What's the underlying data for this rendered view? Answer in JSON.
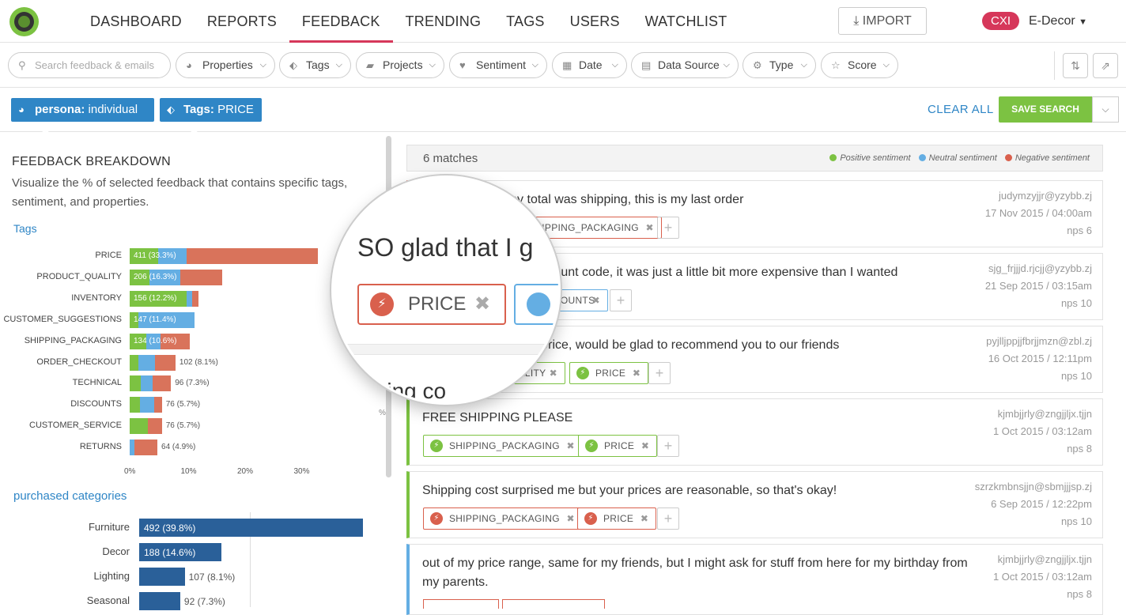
{
  "nav": {
    "items": [
      "DASHBOARD",
      "REPORTS",
      "FEEDBACK",
      "TRENDING",
      "TAGS",
      "USERS",
      "WATCHLIST"
    ],
    "active": "FEEDBACK",
    "import_label": "IMPORT",
    "brand_badge": "CXI",
    "org_name": "E-Decor"
  },
  "filters": {
    "search_placeholder": "Search feedback & emails",
    "buttons": [
      "Properties",
      "Tags",
      "Projects",
      "Sentiment",
      "Date",
      "Data Source",
      "Type",
      "Score"
    ]
  },
  "active_filters": {
    "chips": [
      {
        "key": "persona:",
        "value": "individual",
        "icon": "pie-chart-icon"
      },
      {
        "key": "Tags:",
        "value": "PRICE",
        "icon": "tag-icon"
      }
    ],
    "clear_all": "CLEAR ALL",
    "save_search": "SAVE SEARCH"
  },
  "breakdown": {
    "title": "FEEDBACK BREAKDOWN",
    "description": "Visualize the % of selected feedback that contains specific tags, sentiment, and properties.",
    "tags_label": "Tags",
    "categories_label": "purchased categories",
    "colors": {
      "positive": "#7cc242",
      "neutral": "#64aee3",
      "negative": "#d9735b",
      "category": "#2a6099"
    }
  },
  "chart_data": [
    {
      "type": "bar",
      "orientation": "horizontal",
      "stacked": true,
      "title": "Tags",
      "categories": [
        "PRICE",
        "PRODUCT_QUALITY",
        "INVENTORY",
        "CUSTOMER_SUGGESTIONS",
        "SHIPPING_PACKAGING",
        "ORDER_CHECKOUT",
        "TECHNICAL",
        "DISCOUNTS",
        "CUSTOMER_SERVICE",
        "RETURNS"
      ],
      "labels": [
        "411 (33.3%)",
        "206 (16.3%)",
        "156 (12.2%)",
        "147 (11.4%)",
        "134 (10.6%)",
        "102 (8.1%)",
        "96 (7.3%)",
        "76 (5.7%)",
        "76 (5.7%)",
        "64 (4.9%)"
      ],
      "series": [
        {
          "name": "Positive sentiment",
          "values": [
            5.0,
            3.5,
            10.0,
            1.5,
            3.0,
            1.5,
            2.0,
            1.8,
            3.2,
            0.0
          ]
        },
        {
          "name": "Neutral sentiment",
          "values": [
            5.0,
            5.5,
            1.0,
            9.9,
            2.5,
            3.0,
            2.0,
            2.5,
            0.0,
            0.8
          ]
        },
        {
          "name": "Negative sentiment",
          "values": [
            23.3,
            7.3,
            1.2,
            0.0,
            5.1,
            3.6,
            3.3,
            1.4,
            2.5,
            4.1
          ]
        }
      ],
      "xticks": [
        "0%",
        "10%",
        "20%",
        "30%"
      ],
      "xlim": [
        0,
        33.3
      ]
    },
    {
      "type": "bar",
      "orientation": "horizontal",
      "title": "purchased categories",
      "categories": [
        "Furniture",
        "Decor",
        "Lighting",
        "Seasonal"
      ],
      "values": [
        39.8,
        14.6,
        8.1,
        7.3
      ],
      "labels": [
        "492 (39.8%)",
        "188 (14.6%)",
        "107 (8.1%)",
        "92 (7.3%)"
      ],
      "xlim": [
        0,
        39.8
      ]
    }
  ],
  "results": {
    "matches": "6 matches",
    "legend": [
      {
        "label": "Positive sentiment",
        "color": "#7cc242"
      },
      {
        "label": "Neutral sentiment",
        "color": "#64aee3"
      },
      {
        "label": "Negative sentiment",
        "color": "#d9604d"
      }
    ],
    "cards": [
      {
        "text": "More than half my total was shipping, this is my last order",
        "email": "judymzyjjr@yzybb.zj",
        "date": "17 Nov 2015 / 04:00am",
        "nps": "nps 6",
        "sentiment": "negative",
        "tags": [
          {
            "label": "SHIPPING_PACKAGING",
            "sentiment": "negative"
          }
        ]
      },
      {
        "text": "discount code, it was just a little bit more expensive than I wanted",
        "email": "sjg_frjjjd.rjcjj@yzybb.zj",
        "date": "21 Sep 2015 / 03:15am",
        "nps": "nps 10",
        "sentiment": "neutral",
        "tags": [
          {
            "label": "DISCOUNTS",
            "sentiment": "neutral"
          }
        ]
      },
      {
        "text": "he price, would be glad to recommend you to our friends",
        "email": "pyjlljppjjfbrjjmzn@zbl.zj",
        "date": "16 Oct 2015 / 12:11pm",
        "nps": "nps 10",
        "sentiment": "positive",
        "tags": [
          {
            "label": "QUALITY",
            "sentiment": "positive"
          },
          {
            "label": "PRICE",
            "sentiment": "positive"
          }
        ]
      },
      {
        "text": "FREE SHIPPING PLEASE",
        "email": "kjmbjjrly@zngjjljx.tjjn",
        "date": "1 Oct 2015 / 03:12am",
        "nps": "nps 8",
        "sentiment": "positive",
        "tags": [
          {
            "label": "SHIPPING_PACKAGING",
            "sentiment": "positive"
          },
          {
            "label": "PRICE",
            "sentiment": "positive"
          }
        ]
      },
      {
        "text": "Shipping cost surprised me but your prices are reasonable, so that's okay!",
        "email": "szrzkmbnsjjn@sbmjjjsp.zj",
        "date": "6 Sep 2015 / 12:22pm",
        "nps": "nps 10",
        "sentiment": "positive",
        "tags": [
          {
            "label": "SHIPPING_PACKAGING",
            "sentiment": "negative"
          },
          {
            "label": "PRICE",
            "sentiment": "negative"
          }
        ]
      },
      {
        "text": "out of my price range, same for my friends, but I might ask for stuff from here for my birthday from my parents.",
        "email": "kjmbjjrly@zngjjljx.tjjn",
        "date": "1 Oct 2015 / 03:12am",
        "nps": "nps 8",
        "sentiment": "neutral",
        "tags": []
      }
    ]
  },
  "magnifier": {
    "text": "SO glad that I g",
    "tag_label": "PRICE",
    "text2": "ipping co"
  }
}
